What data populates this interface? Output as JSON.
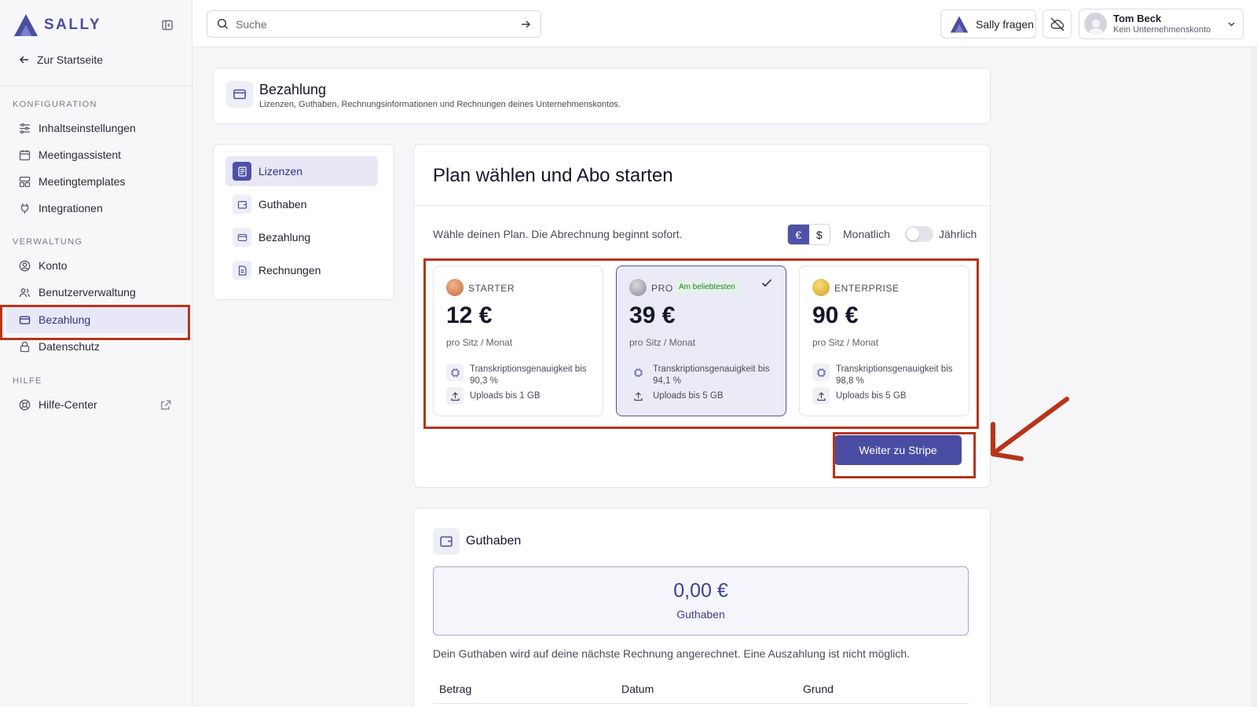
{
  "app": {
    "brand": "SALLY"
  },
  "sidebar": {
    "back_label": "Zur Startseite",
    "sections": {
      "config": "KONFIGURATION",
      "admin": "VERWALTUNG",
      "help": "HILFE"
    },
    "items": {
      "content": "Inhaltseinstellungen",
      "assistant": "Meetingassistent",
      "templates": "Meetingtemplates",
      "integrations": "Integrationen",
      "account": "Konto",
      "users": "Benutzerverwaltung",
      "billing": "Bezahlung",
      "privacy": "Datenschutz",
      "helpcenter": "Hilfe-Center"
    }
  },
  "topbar": {
    "search_placeholder": "Suche",
    "ask_label": "Sally fragen",
    "user_name": "Tom Beck",
    "user_sub": "Kein Unternehmenskonto"
  },
  "header": {
    "title": "Bezahlung",
    "subtitle": "Lizenzen, Guthaben, Rechnungsinformationen und Rechnungen deines Unternehmenskontos."
  },
  "subnav": {
    "licenses": "Lizenzen",
    "credit": "Guthaben",
    "billing": "Bezahlung",
    "invoices": "Rechnungen"
  },
  "plans": {
    "title": "Plan wählen und Abo starten",
    "hint": "Wähle deinen Plan. Die Abrechnung beginnt sofort.",
    "currency_eur": "€",
    "currency_usd": "$",
    "billing_monthly": "Monatlich",
    "billing_yearly": "Jährlich",
    "tiers": [
      {
        "name": "STARTER",
        "price": "12 €",
        "per": "pro Sitz / Monat",
        "accuracy": "Transkriptionsgenauigkeit bis 90,3 %",
        "uploads": "Uploads bis 1 GB"
      },
      {
        "name": "PRO",
        "badge": "Am beliebtesten",
        "price": "39 €",
        "per": "pro Sitz / Monat",
        "accuracy": "Transkriptionsgenauigkeit bis 94,1 %",
        "uploads": "Uploads bis 5 GB"
      },
      {
        "name": "ENTERPRISE",
        "price": "90 €",
        "per": "pro Sitz / Monat",
        "accuracy": "Transkriptionsgenauigkeit bis 98,8 %",
        "uploads": "Uploads bis 5 GB"
      }
    ],
    "cta": "Weiter zu Stripe"
  },
  "credit": {
    "title": "Guthaben",
    "balance": "0,00 €",
    "balance_label": "Guthaben",
    "note": "Dein Guthaben wird auf deine nächste Rechnung angerechnet. Eine Auszahlung ist nicht möglich.",
    "columns": [
      "Betrag",
      "Datum",
      "Grund"
    ]
  },
  "colors": {
    "accent": "#4f51a8",
    "highlight": "#b8341a"
  }
}
